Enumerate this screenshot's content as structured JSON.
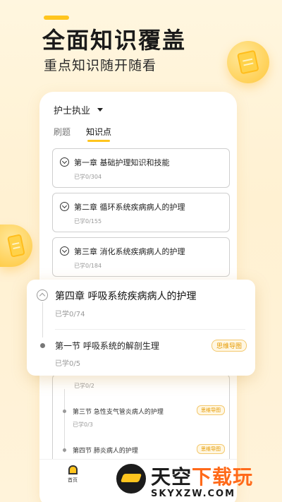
{
  "header": {
    "title": "全面知识覆盖",
    "subtitle": "重点知识随开随看"
  },
  "colors": {
    "accent": "#ffc51e",
    "mindmap_badge": "#e59a00"
  },
  "dropdown": {
    "label": "护士执业",
    "icon": "caret-down-icon"
  },
  "tabs": [
    {
      "label": "刷题",
      "active": false
    },
    {
      "label": "知识点",
      "active": true
    }
  ],
  "chapters": [
    {
      "title": "第一章  基础护理知识和技能",
      "progress": "已学0/304"
    },
    {
      "title": "第二章  循环系统疾病病人的护理",
      "progress": "已学0/155"
    },
    {
      "title": "第三章  消化系统疾病病人的护理",
      "progress": "已学0/184"
    }
  ],
  "expanded_chapter": {
    "title": "第四章  呼吸系统疾病病人的护理",
    "progress": "已学0/74",
    "section": {
      "title": "第一节  呼吸系统的解剖生理",
      "progress": "已学0/5",
      "badge": "思维导图"
    }
  },
  "lower_sections": {
    "first_progress": "已学0/2",
    "items": [
      {
        "title": "第三节  急性支气管炎病人的护理",
        "progress": "已学0/3",
        "badge": "思维导图"
      },
      {
        "title": "第四节  肺炎病人的护理",
        "progress": "",
        "badge": "思维导图"
      }
    ]
  },
  "navbar": {
    "home_label": "首页"
  },
  "watermark": {
    "part1": "天空",
    "part2": "下载玩",
    "url": "SKYXZW.COM"
  }
}
